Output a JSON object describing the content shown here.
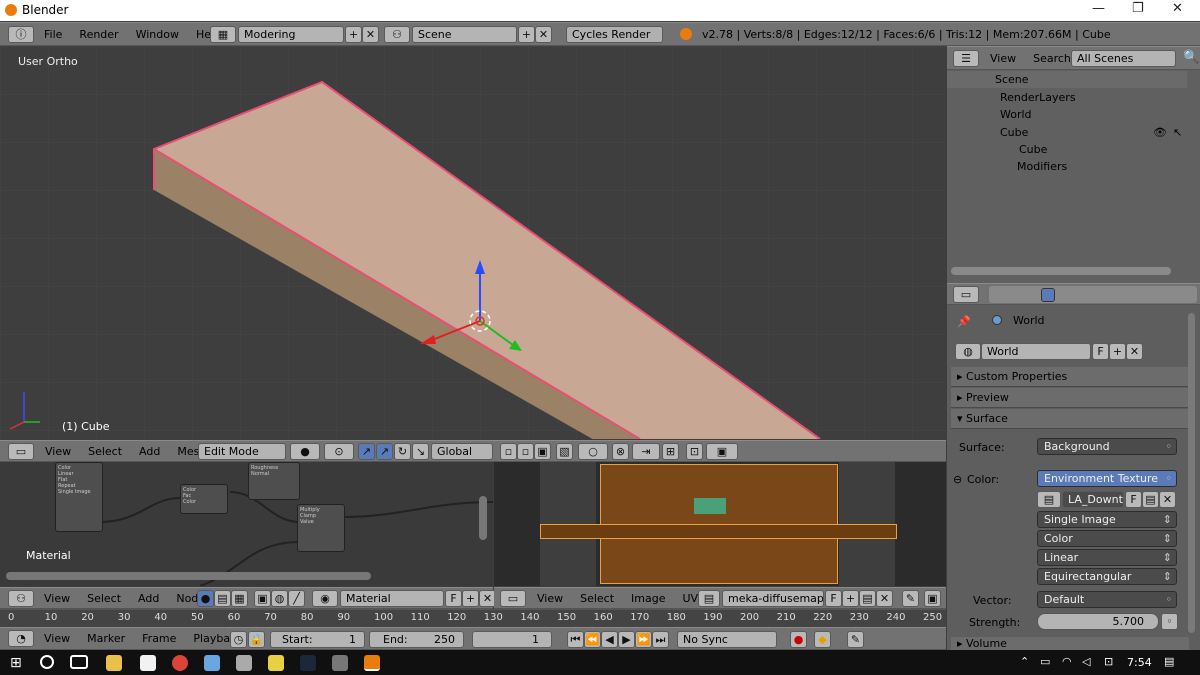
{
  "window": {
    "title": "Blender",
    "min": "—",
    "max": "❐",
    "close": "✕"
  },
  "info_header": {
    "menus": [
      "File",
      "Render",
      "Window",
      "Help"
    ],
    "screen_layout": "Modering",
    "scene": "Scene",
    "render_engine": "Cycles Render",
    "stats": "v2.78 | Verts:8/8 | Edges:12/12 | Faces:6/6 | Tris:12 | Mem:207.66M | Cube"
  },
  "viewport": {
    "view_label": "User Ortho",
    "object_label": "(1) Cube",
    "menus": [
      "View",
      "Select",
      "Add",
      "Mesh"
    ],
    "mode": "Edit Mode",
    "orientation": "Global",
    "colors": {
      "face": "#c8a895",
      "side": "#9b8166",
      "edge": "#e94e74"
    }
  },
  "node_editor": {
    "label": "Material",
    "menus": [
      "View",
      "Select",
      "Add",
      "Node"
    ],
    "material": "Material",
    "f": "F",
    "nodes": [
      "Color",
      "Linear",
      "Flat",
      "Repeat",
      "Single Image",
      "Color",
      "Fac",
      "Color",
      "Roughness",
      "Normal",
      "Multiply",
      "Clamp",
      "Value"
    ]
  },
  "image_editor": {
    "menus": [
      "View",
      "Select",
      "Image",
      "UVs"
    ],
    "image": "meka-diffusemap.png",
    "f": "F"
  },
  "timeline": {
    "menus": [
      "View",
      "Marker",
      "Frame",
      "Playback"
    ],
    "start_label": "Start:",
    "start": "1",
    "end_label": "End:",
    "end": "250",
    "current": "1",
    "sync": "No Sync",
    "ruler": [
      "0",
      "10",
      "20",
      "30",
      "40",
      "50",
      "60",
      "70",
      "80",
      "90",
      "100",
      "110",
      "120",
      "130",
      "140",
      "150",
      "160",
      "170",
      "180",
      "190",
      "200",
      "210",
      "220",
      "230",
      "240",
      "250"
    ]
  },
  "outliner": {
    "menus": [
      "View",
      "Search"
    ],
    "filter": "All Scenes",
    "items": [
      "Scene",
      "RenderLayers",
      "World",
      "Cube",
      "Cube",
      "Modifiers"
    ]
  },
  "properties": {
    "breadcrumb": "World",
    "world_name": "World",
    "f": "F",
    "panels": {
      "custom": "Custom Properties",
      "preview": "Preview",
      "surface": "Surface",
      "volume": "Volume"
    },
    "surface_label": "Surface:",
    "surface": "Background",
    "color_label": "Color:",
    "color": "Environment Texture",
    "image": "LA_Downt...",
    "image_f": "F",
    "projection1": "Single Image",
    "projection2": "Color",
    "interpolation": "Linear",
    "mapping": "Equirectangular",
    "vector_label": "Vector:",
    "vector": "Default",
    "strength_label": "Strength:",
    "strength": "5.700"
  },
  "taskbar": {
    "time": "7:54"
  }
}
